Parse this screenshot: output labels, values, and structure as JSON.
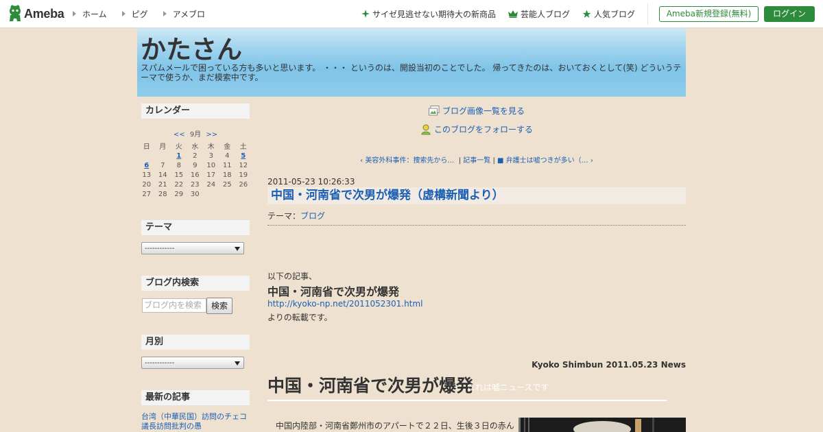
{
  "header": {
    "logo_text": "Ameba",
    "nav_left": [
      {
        "label": "ホーム"
      },
      {
        "label": "ピグ"
      },
      {
        "label": "アメブロ"
      }
    ],
    "nav_right": [
      {
        "label": "サイゼ見逃せない期待大の新商品",
        "icon": "sparkle-icon"
      },
      {
        "label": "芸能人ブログ",
        "icon": "crown-icon"
      },
      {
        "label": "人気ブログ",
        "icon": "star-icon"
      }
    ],
    "register_label": "Ameba新規登録(無料)",
    "login_label": "ログイン",
    "brand_color": "#2d8c3c"
  },
  "banner": {
    "title": "かたさん",
    "description": "スパムメールで困っている方も多いと思います。 ・・・ というのは、開設当初のことでした。 帰ってきたのは、おいておくとして(笑) どういうテーマで使うか、まだ模索中です。"
  },
  "sidebar": {
    "calendar": {
      "heading": "カレンダー",
      "prev": "<<",
      "month": "9月",
      "next": ">>",
      "weekdays": [
        "日",
        "月",
        "火",
        "水",
        "木",
        "金",
        "土"
      ],
      "weeks": [
        [
          "",
          "",
          "1",
          "2",
          "3",
          "4",
          "5"
        ],
        [
          "6",
          "7",
          "8",
          "9",
          "10",
          "11",
          "12"
        ],
        [
          "13",
          "14",
          "15",
          "16",
          "17",
          "18",
          "19"
        ],
        [
          "20",
          "21",
          "22",
          "23",
          "24",
          "25",
          "26"
        ],
        [
          "27",
          "28",
          "29",
          "30",
          "",
          "",
          ""
        ]
      ],
      "linked_days": [
        "1",
        "5",
        "6"
      ]
    },
    "theme": {
      "heading": "テーマ",
      "select_value": "------------"
    },
    "search": {
      "heading": "ブログ内検索",
      "placeholder": "ブログ内を検索",
      "button": "検索"
    },
    "monthly": {
      "heading": "月別",
      "select_value": "------------"
    },
    "recent": {
      "heading": "最新の記事",
      "first_item": "台湾（中華民国）訪問のチェコ議長訪問批判の愚"
    }
  },
  "main": {
    "image_list_link": "ブログ画像一覧を見る",
    "follow_link": "このブログをフォローする",
    "pager": {
      "prev": "美容外科事件：捜索先から…",
      "list": "記事一覧",
      "next": "■ 弁護士は嘘つきが多い（…"
    },
    "entry": {
      "date": "2011-05-23 10:26:33",
      "title": "中国・河南省で次男が爆発（虚構新聞より）",
      "theme_label": "テーマ：",
      "theme_value": "ブログ",
      "intro": "以下の記事、",
      "subheading": "中国・河南省で次男が爆発",
      "url": "http://kyoko-np.net/2011052301.html",
      "outro": "よりの転載です。",
      "news_meta": "Kyoko Shimbun 2011.05.23 News",
      "news_title": "中国・河南省で次男が爆発",
      "news_note": "これは嘘ニュースです",
      "news_body": "中国内陸部・河南省鄭州市のアパートで２２日、生後３日の赤ん"
    }
  }
}
